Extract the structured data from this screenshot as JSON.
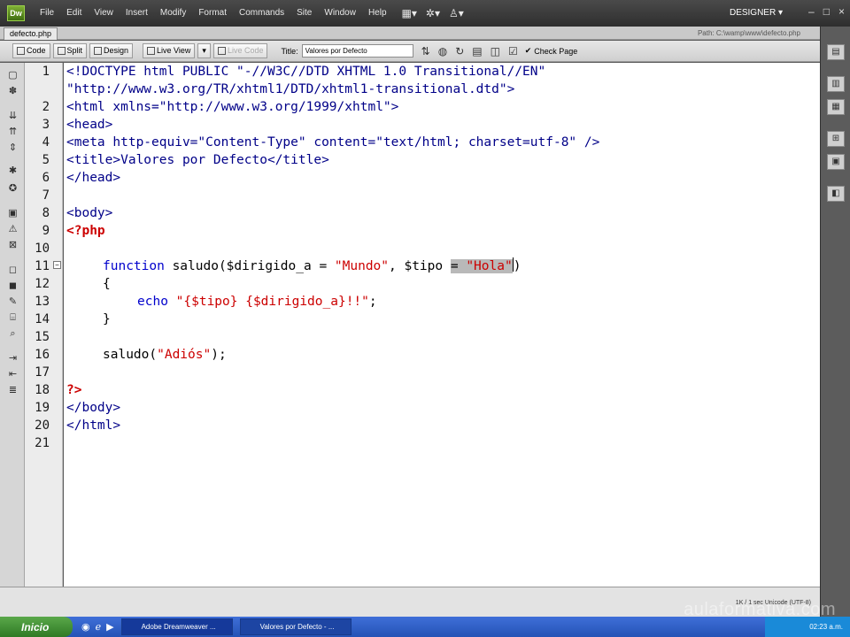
{
  "app": {
    "logo": "Dw",
    "menus": [
      "File",
      "Edit",
      "View",
      "Insert",
      "Modify",
      "Format",
      "Commands",
      "Site",
      "Window",
      "Help"
    ],
    "workspace": "DESIGNER ▾",
    "window_controls": [
      "–",
      "□",
      "×"
    ]
  },
  "document": {
    "tab": "defecto.php",
    "path": "Path: C:\\wamp\\www\\defecto.php"
  },
  "toolbar": {
    "code": "Code",
    "split": "Split",
    "design": "Design",
    "live_view": "Live View",
    "live_code": "Live Code",
    "title_label": "Title:",
    "title_value": "Valores por Defecto",
    "check_page": "Check Page"
  },
  "code": {
    "line_numbers": [
      "1",
      "2",
      "3",
      "4",
      "5",
      "6",
      "7",
      "8",
      "9",
      "10",
      "11",
      "12",
      "13",
      "14",
      "15",
      "16",
      "17",
      "18",
      "19",
      "20",
      "21"
    ],
    "l1": "<!DOCTYPE html PUBLIC \"-//W3C//DTD XHTML 1.0 Transitional//EN\"",
    "l1b": "\"http://www.w3.org/TR/xhtml1/DTD/xhtml1-transitional.dtd\">",
    "l2": "<html xmlns=\"http://www.w3.org/1999/xhtml\">",
    "l3": "<head>",
    "l4": "<meta http-equiv=\"Content-Type\" content=\"text/html; charset=utf-8\" />",
    "l5": "<title>Valores por Defecto</title>",
    "l6": "</head>",
    "l8": "<body>",
    "l9": "<?php",
    "l11_fn": "function",
    "l11_a": " saludo($dirigido_a = ",
    "l11_s1": "\"Mundo\"",
    "l11_b": ", $tipo ",
    "l11_sel_eq": "= ",
    "l11_sel_str": "\"Hola\"",
    "l11_c": ")",
    "l12": "{",
    "l13_kw": "echo",
    "l13_str": " \"{$tipo} {$dirigido_a}!!\"",
    "l13_end": ";",
    "l14": "}",
    "l16_a": "saludo(",
    "l16_str": "\"Adiós\"",
    "l16_b": ");",
    "l18": "?>",
    "l19": "</body>",
    "l20": "</html>"
  },
  "status": {
    "right": "1K / 1 sec   Unicode (UTF-8)"
  },
  "taskbar": {
    "start": "Inicio",
    "task1": "Adobe Dreamweaver ...",
    "task2": "Valores por Defecto - ...",
    "clock": "02:23 a.m."
  },
  "watermark": "aulaformativa.com"
}
